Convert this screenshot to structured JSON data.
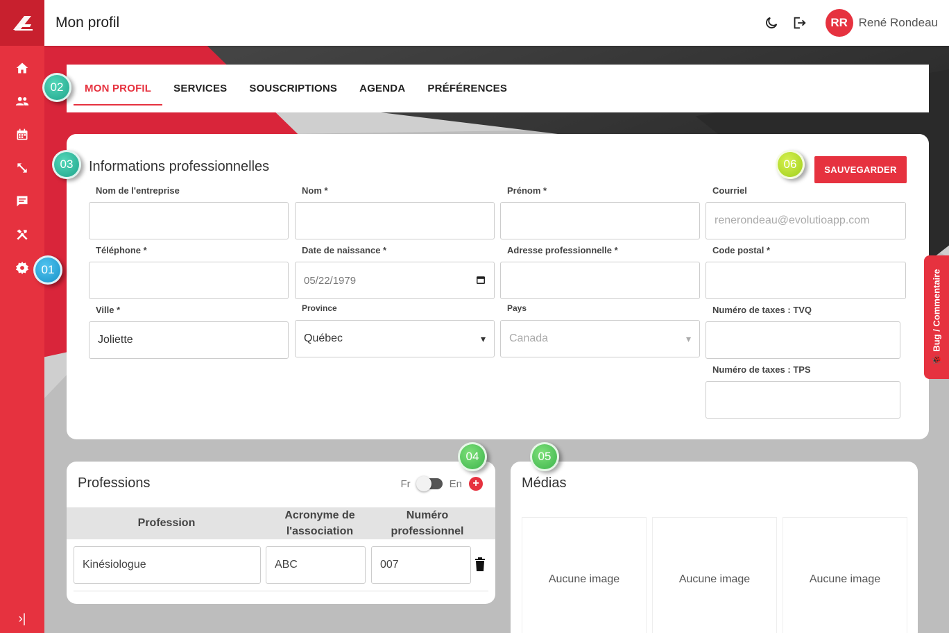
{
  "header": {
    "title": "Mon profil",
    "user_initials": "RR",
    "user_name": "René Rondeau"
  },
  "sidebar": {
    "items": [
      {
        "icon": "home-icon"
      },
      {
        "icon": "users-icon"
      },
      {
        "icon": "calendar-icon"
      },
      {
        "icon": "expand-icon"
      },
      {
        "icon": "chat-icon"
      },
      {
        "icon": "tools-icon"
      },
      {
        "icon": "gear-icon"
      }
    ],
    "collapse_label": "›|"
  },
  "tabs": [
    {
      "label": "MON PROFIL",
      "active": true
    },
    {
      "label": "SERVICES"
    },
    {
      "label": "SOUSCRIPTIONS"
    },
    {
      "label": "AGENDA"
    },
    {
      "label": "PRÉFÉRENCES"
    }
  ],
  "info": {
    "title": "Informations professionnelles",
    "save_label": "SAUVEGARDER",
    "fields": {
      "entreprise": {
        "label": "Nom de l'entreprise",
        "value": ""
      },
      "nom": {
        "label": "Nom *",
        "value": ""
      },
      "prenom": {
        "label": "Prénom *",
        "value": ""
      },
      "courriel": {
        "label": "Courriel",
        "value": "renerondeau@evolutioapp.com"
      },
      "telephone": {
        "label": "Téléphone *",
        "value": ""
      },
      "naissance": {
        "label": "Date de naissance *",
        "value": "05/22/1979"
      },
      "adresse": {
        "label": "Adresse professionnelle *",
        "value": ""
      },
      "postal": {
        "label": "Code postal *",
        "value": ""
      },
      "ville": {
        "label": "Ville *",
        "value": "Joliette"
      },
      "province": {
        "label": "Province",
        "value": "Québec"
      },
      "pays": {
        "label": "Pays",
        "value": "Canada"
      },
      "tvq": {
        "label": "Numéro de taxes : TVQ",
        "value": ""
      },
      "tps": {
        "label": "Numéro de taxes : TPS",
        "value": ""
      }
    }
  },
  "professions": {
    "title": "Professions",
    "lang_fr": "Fr",
    "lang_en": "En",
    "add_label": "+",
    "columns": [
      "Profession",
      "Acronyme de l'association",
      "Numéro professionnel"
    ],
    "rows": [
      {
        "profession": "Kinésiologue",
        "acronyme": "ABC",
        "numero": "007"
      }
    ]
  },
  "medias": {
    "title": "Médias",
    "slots": [
      "Aucune image",
      "Aucune image",
      "Aucune image"
    ]
  },
  "bug_tab": "🐞 Bug / Commentaire",
  "badges": [
    "01",
    "02",
    "03",
    "04",
    "05",
    "06"
  ],
  "colors": {
    "accent": "#e6323f",
    "sidebar": "#e6323f"
  }
}
